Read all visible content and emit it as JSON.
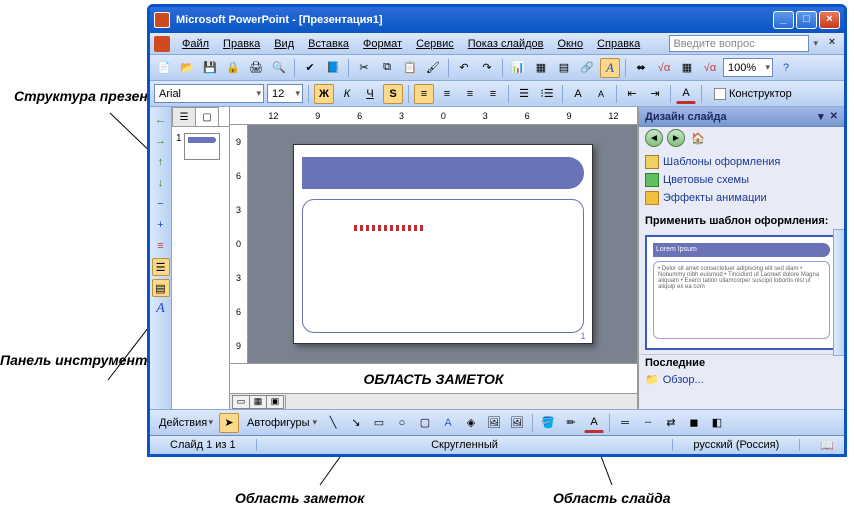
{
  "title": "Microsoft PowerPoint - [Презентация1]",
  "menu": {
    "file": "Файл",
    "edit": "Правка",
    "view": "Вид",
    "insert": "Вставка",
    "format": "Формат",
    "tools": "Сервис",
    "slideshow": "Показ слайдов",
    "window": "Окно",
    "help": "Справка"
  },
  "ask_placeholder": "Введите вопрос",
  "font": {
    "name": "Arial",
    "size": "12"
  },
  "zoom": "100%",
  "bold": "Ж",
  "italic": "К",
  "underline": "Ч",
  "shadow": "S",
  "designer": "Конструктор",
  "ruler_h": [
    "12",
    "9",
    "6",
    "3",
    "0",
    "3",
    "6",
    "9",
    "12"
  ],
  "ruler_v": [
    "9",
    "6",
    "3",
    "0",
    "3",
    "6",
    "9"
  ],
  "slide_page": "1",
  "thumb_num": "1",
  "notes": "ОБЛАСТЬ ЗАМЕТОК",
  "taskpane": {
    "title": "Дизайн слайда",
    "templates": "Шаблоны оформления",
    "colors": "Цветовые схемы",
    "effects": "Эффекты анимации",
    "apply": "Применить шаблон оформления:",
    "preview_title": "Lorem Ipsum",
    "preview_body": "• Delor sit amet consectetuer adipiscing elit sed diam\n  • Nonummy nibh euismod\n    • Tincidunt ut\n      Laoreet dolore\n      Magna aliquam\n    • Exerci tation ullamcorper suscipit lobortis nisl ut aliquip ex ea com",
    "recent": "Последние",
    "browse": "Обзор..."
  },
  "draw": {
    "actions": "Действия",
    "autoshapes": "Автофигуры"
  },
  "status": {
    "slide": "Слайд 1 из 1",
    "layout": "Скругленный",
    "lang": "русский (Россия)"
  },
  "annotations": {
    "structure": "Структура презентации",
    "panel": "Панель инструментов Структура",
    "notes_area": "Область заметок",
    "slide_area": "Область слайда"
  }
}
